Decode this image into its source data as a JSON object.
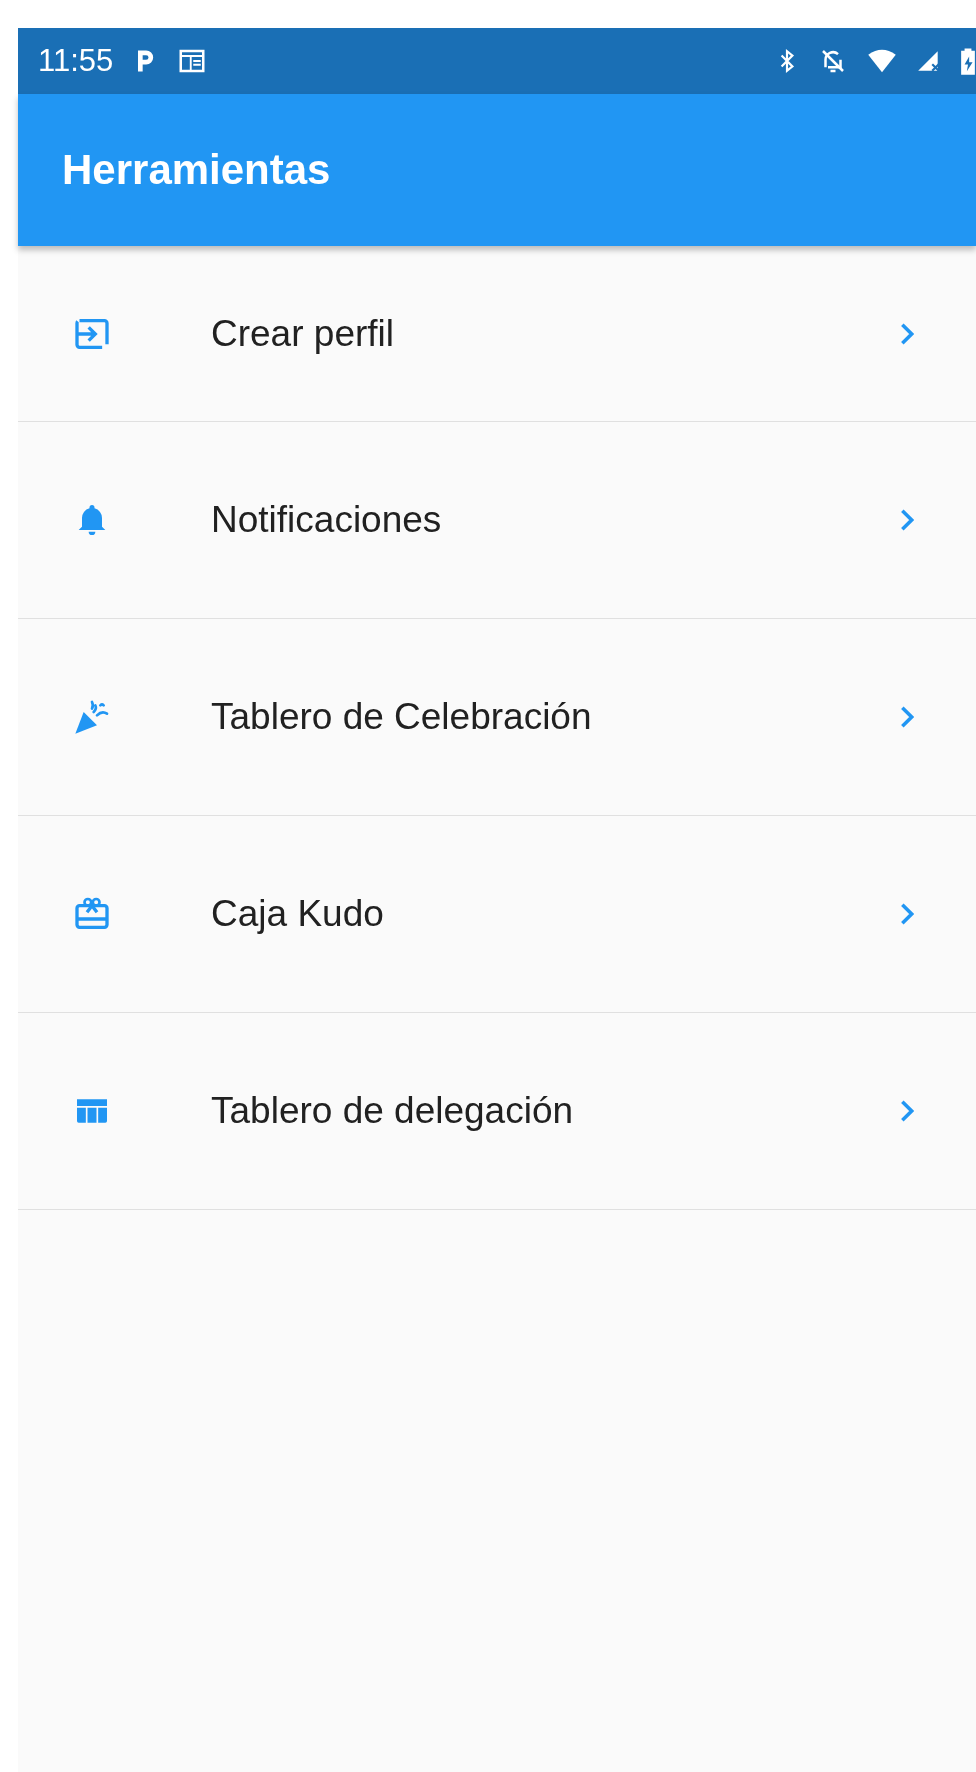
{
  "status_bar": {
    "time": "11:55"
  },
  "app_bar": {
    "title": "Herramientas"
  },
  "items": [
    {
      "label": "Crear perfil",
      "kind": "input"
    },
    {
      "label": "Notificaciones",
      "kind": "bell"
    },
    {
      "label": "Tablero de Celebración",
      "kind": "party"
    },
    {
      "label": "Caja Kudo",
      "kind": "gift"
    },
    {
      "label": "Tablero de delegación",
      "kind": "board"
    }
  ]
}
